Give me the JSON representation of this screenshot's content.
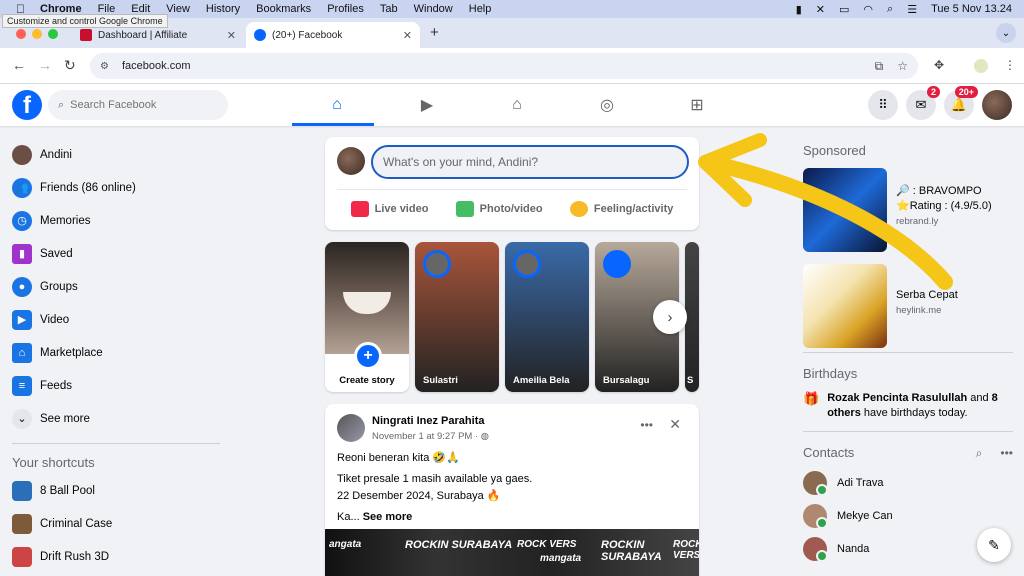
{
  "menubar": {
    "app": "Chrome",
    "items": [
      "File",
      "Edit",
      "View",
      "History",
      "Bookmarks",
      "Profiles",
      "Tab",
      "Window",
      "Help"
    ],
    "clock": "Tue 5 Nov  13.24",
    "tooltip": "Customize and control Google Chrome"
  },
  "tabs": [
    {
      "title": "Dashboard | Affiliate",
      "favicon_color": "#c8102e"
    },
    {
      "title": "(20+) Facebook",
      "favicon_color": "#0866ff"
    }
  ],
  "address": {
    "url": "facebook.com"
  },
  "fb": {
    "logo": "f",
    "search_placeholder": "Search Facebook",
    "messenger_badge": "2",
    "notif_badge": "20+"
  },
  "leftbar": {
    "items": [
      {
        "label": "Andini",
        "icon": "profile-avatar",
        "color": "#6b4f45"
      },
      {
        "label": "Friends (86 online)",
        "icon": "friends-icon",
        "color": "#1b74e4"
      },
      {
        "label": "Memories",
        "icon": "memories-icon",
        "color": "#1b74e4"
      },
      {
        "label": "Saved",
        "icon": "saved-icon",
        "color": "#a033cc"
      },
      {
        "label": "Groups",
        "icon": "groups-icon",
        "color": "#1b74e4"
      },
      {
        "label": "Video",
        "icon": "video-icon",
        "color": "#1b74e4"
      },
      {
        "label": "Marketplace",
        "icon": "marketplace-icon",
        "color": "#1b74e4"
      },
      {
        "label": "Feeds",
        "icon": "feeds-icon",
        "color": "#1b74e4"
      }
    ],
    "see_more": "See more",
    "shortcuts_title": "Your shortcuts",
    "shortcuts": [
      {
        "label": "8 Ball Pool",
        "color": "#2a6fb8"
      },
      {
        "label": "Criminal Case",
        "color": "#7d5a3a"
      },
      {
        "label": "Drift Rush 3D",
        "color": "#c44"
      }
    ]
  },
  "composer": {
    "placeholder": "What's on your mind, Andini?",
    "actions": [
      {
        "label": "Live video",
        "color": "#f02849"
      },
      {
        "label": "Photo/video",
        "color": "#45bd62"
      },
      {
        "label": "Feeling/activity",
        "color": "#f7b928"
      }
    ]
  },
  "stories": {
    "create_label": "Create story",
    "items": [
      {
        "name": "Sulastri",
        "bg": "#a8553a"
      },
      {
        "name": "Ameilia Bela",
        "bg": "#3a6aa8"
      },
      {
        "name": "Bursalagu",
        "bg": "#b7a99a"
      },
      {
        "name": "S",
        "bg": "#444"
      }
    ]
  },
  "post": {
    "author": "Ningrati Inez Parahita",
    "meta": "November 1 at 9:27 PM · ",
    "lines": [
      "Reoni beneran kita 🤣🙏",
      "Tiket presale 1 masih available ya gaes.",
      "22 Desember 2024, Surabaya 🔥",
      "Ka..."
    ],
    "see_more": "See more",
    "banner_words": [
      "angata",
      "ROCKIN SURABAYA",
      "ROCK VERS",
      "mangata",
      "ROCKIN SURABAYA",
      "ROCK VERS"
    ]
  },
  "right": {
    "sponsored_title": "Sponsored",
    "ads": [
      {
        "title_line1": "🔎 : BRAVOMPO",
        "title_line2": "⭐Rating : (4.9/5.0)",
        "domain": "rebrand.ly"
      },
      {
        "title_line1": "Serba Cepat",
        "title_line2": "",
        "domain": "heylink.me"
      }
    ],
    "birthdays_title": "Birthdays",
    "birthday_name": "Rozak Pencinta Rasulullah",
    "birthday_and": " and ",
    "birthday_others": "8 others",
    "birthday_tail": " have birthdays today.",
    "contacts_title": "Contacts",
    "contacts": [
      {
        "name": "Adi Trava",
        "color": "#8a6a50"
      },
      {
        "name": "Mekye Can",
        "color": "#b08870"
      },
      {
        "name": "Nanda",
        "color": "#a05a50"
      }
    ]
  }
}
